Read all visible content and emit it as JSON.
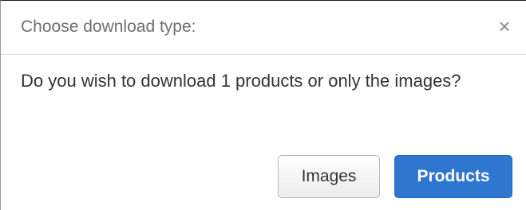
{
  "dialog": {
    "title": "Choose download type:",
    "close_glyph": "×",
    "message": "Do you wish to download 1 products or only the images?",
    "buttons": {
      "images_label": "Images",
      "products_label": "Products"
    }
  },
  "colors": {
    "primary": "#2f76d0",
    "title_text": "#6f6f6f",
    "body_text": "#333333"
  }
}
